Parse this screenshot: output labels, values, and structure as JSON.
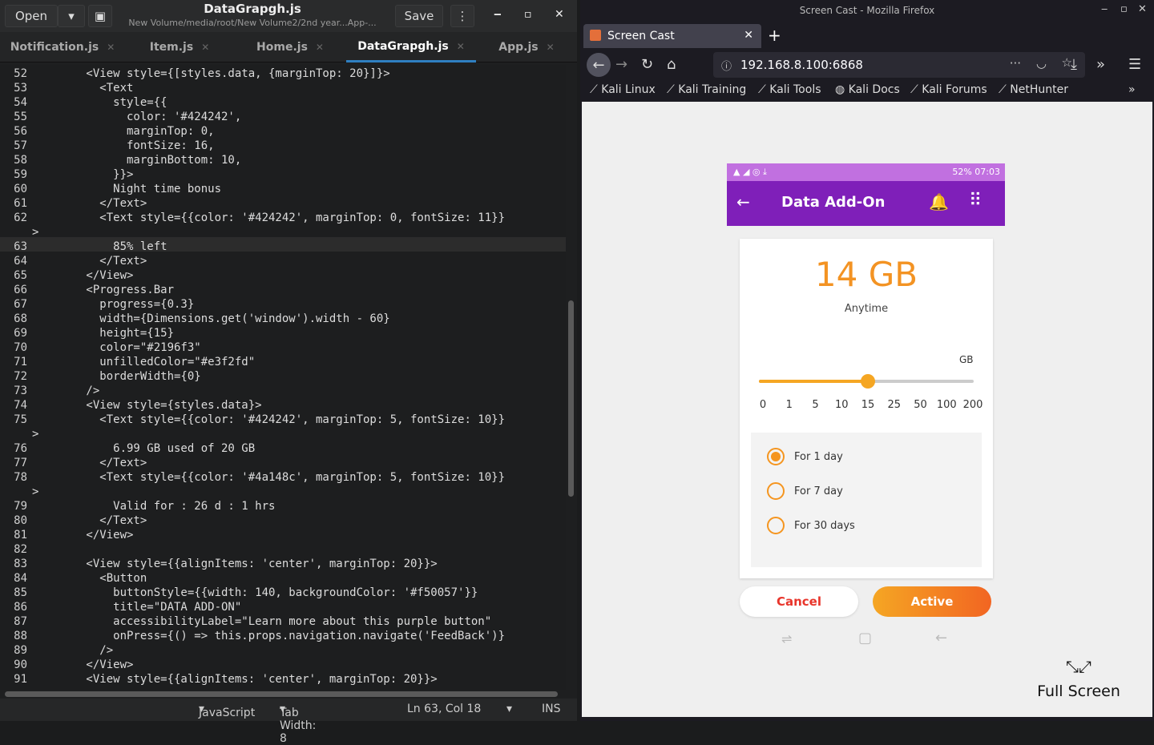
{
  "editor": {
    "open_label": "Open",
    "save_label": "Save",
    "title": "DataGrapgh.js",
    "subtitle": "New Volume/media/root/New Volume2/2nd year...App-...",
    "tabs": [
      {
        "label": "Notification.js"
      },
      {
        "label": "Item.js"
      },
      {
        "label": "Home.js"
      },
      {
        "label": "DataGrapgh.js",
        "active": true
      },
      {
        "label": "App.js"
      }
    ],
    "lines": [
      {
        "n": "52",
        "t": "        <View style={[styles.data, {marginTop: 20}]}>"
      },
      {
        "n": "53",
        "t": "          <Text"
      },
      {
        "n": "54",
        "t": "            style={{"
      },
      {
        "n": "55",
        "t": "              color: '#424242',"
      },
      {
        "n": "56",
        "t": "              marginTop: 0,"
      },
      {
        "n": "57",
        "t": "              fontSize: 16,"
      },
      {
        "n": "58",
        "t": "              marginBottom: 10,"
      },
      {
        "n": "59",
        "t": "            }}>"
      },
      {
        "n": "60",
        "t": "            Night time bonus"
      },
      {
        "n": "61",
        "t": "          </Text>"
      },
      {
        "n": "62",
        "t": "          <Text style={{color: '#424242', marginTop: 0, fontSize: 11}}"
      },
      {
        "n": "",
        "t": ">"
      },
      {
        "n": "63",
        "t": "            85% left"
      },
      {
        "n": "64",
        "t": "          </Text>"
      },
      {
        "n": "65",
        "t": "        </View>"
      },
      {
        "n": "66",
        "t": "        <Progress.Bar"
      },
      {
        "n": "67",
        "t": "          progress={0.3}"
      },
      {
        "n": "68",
        "t": "          width={Dimensions.get('window').width - 60}"
      },
      {
        "n": "69",
        "t": "          height={15}"
      },
      {
        "n": "70",
        "t": "          color=\"#2196f3\""
      },
      {
        "n": "71",
        "t": "          unfilledColor=\"#e3f2fd\""
      },
      {
        "n": "72",
        "t": "          borderWidth={0}"
      },
      {
        "n": "73",
        "t": "        />"
      },
      {
        "n": "74",
        "t": "        <View style={styles.data}>"
      },
      {
        "n": "75",
        "t": "          <Text style={{color: '#424242', marginTop: 5, fontSize: 10}}"
      },
      {
        "n": "",
        "t": ">"
      },
      {
        "n": "76",
        "t": "            6.99 GB used of 20 GB"
      },
      {
        "n": "77",
        "t": "          </Text>"
      },
      {
        "n": "78",
        "t": "          <Text style={{color: '#4a148c', marginTop: 5, fontSize: 10}}"
      },
      {
        "n": "",
        "t": ">"
      },
      {
        "n": "79",
        "t": "            Valid for : 26 d : 1 hrs"
      },
      {
        "n": "80",
        "t": "          </Text>"
      },
      {
        "n": "81",
        "t": "        </View>"
      },
      {
        "n": "82",
        "t": ""
      },
      {
        "n": "83",
        "t": "        <View style={{alignItems: 'center', marginTop: 20}}>"
      },
      {
        "n": "84",
        "t": "          <Button"
      },
      {
        "n": "85",
        "t": "            buttonStyle={{width: 140, backgroundColor: '#f50057'}}"
      },
      {
        "n": "86",
        "t": "            title=\"DATA ADD-ON\""
      },
      {
        "n": "87",
        "t": "            accessibilityLabel=\"Learn more about this purple button\""
      },
      {
        "n": "88",
        "t": "            onPress={() => this.props.navigation.navigate('FeedBack')}"
      },
      {
        "n": "89",
        "t": "          />"
      },
      {
        "n": "90",
        "t": "        </View>"
      },
      {
        "n": "91",
        "t": "        <View style={{alignItems: 'center', marginTop: 20}}>"
      }
    ],
    "status": {
      "language": "JavaScript",
      "tab_width": "Tab Width: 8",
      "position": "Ln 63, Col 18",
      "mode": "INS"
    }
  },
  "firefox": {
    "window_title": "Screen Cast - Mozilla Firefox",
    "tab_title": "Screen Cast",
    "url": "192.168.8.100:6868",
    "bookmarks": [
      "Kali Linux",
      "Kali Training",
      "Kali Tools",
      "Kali Docs",
      "Kali Forums",
      "NetHunter"
    ],
    "fullscreen_label": "Full Screen"
  },
  "phone": {
    "status_right": "52% 07:03",
    "title": "Data Add-On",
    "amount": "14 GB",
    "period": "Anytime",
    "unit": "GB",
    "ticks": [
      "0",
      "1",
      "5",
      "10",
      "15",
      "25",
      "50",
      "100",
      "200"
    ],
    "slider_index": 4,
    "options": [
      {
        "label": "For 1 day",
        "selected": true
      },
      {
        "label": "For 7 day",
        "selected": false
      },
      {
        "label": "For 30 days",
        "selected": false
      }
    ],
    "cancel_label": "Cancel",
    "active_label": "Active",
    "colors": {
      "purple": "#7f1fb9",
      "orange": "#f5951f",
      "cancel_red": "#e8352b"
    }
  }
}
